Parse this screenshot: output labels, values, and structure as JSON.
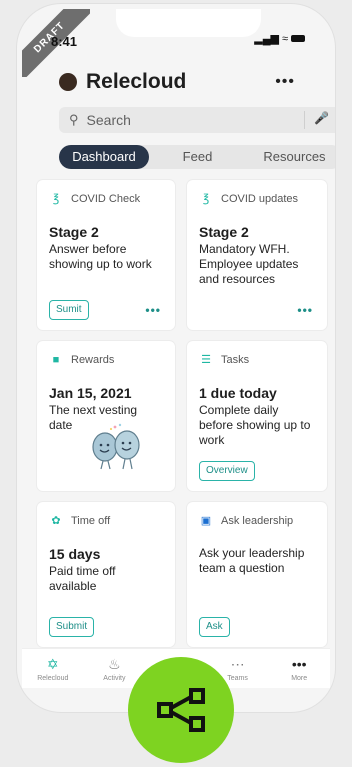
{
  "status_bar": {
    "time": "8:41",
    "signal": "▂▄▆",
    "wifi": "≈"
  },
  "draft_label": "DRAFT",
  "header": {
    "title": "Relecloud",
    "more": "•••"
  },
  "search": {
    "placeholder": "Search"
  },
  "tabs": [
    {
      "label": "Dashboard",
      "active": true
    },
    {
      "label": "Feed",
      "active": false
    },
    {
      "label": "Resources",
      "active": false
    }
  ],
  "cards": {
    "covid_check": {
      "label": "COVID Check",
      "title": "Stage 2",
      "body": "Answer before showing up to work",
      "button": "Sumit",
      "more": "•••"
    },
    "covid_updates": {
      "label": "COVID updates",
      "title": "Stage 2",
      "body": "Mandatory WFH. Employee updates and resources",
      "more": "•••"
    },
    "rewards": {
      "label": "Rewards",
      "title": "Jan 15, 2021",
      "body": "The next vesting date"
    },
    "tasks": {
      "label": "Tasks",
      "title": "1 due today",
      "body": "Complete daily before showing up to work",
      "button": "Overview"
    },
    "time_off": {
      "label": "Time off",
      "title": "15 days",
      "body": "Paid time off available",
      "button": "Submit"
    },
    "leadership": {
      "label": "Ask leadership",
      "body": "Ask your leadership team a question",
      "button": "Ask"
    }
  },
  "nav": [
    {
      "label": "Relecloud",
      "icon": "relecloud-app-icon",
      "active": true
    },
    {
      "label": "Activity",
      "icon": "bell-icon",
      "active": false
    },
    {
      "label": "",
      "icon": "chat-icon",
      "active": false
    },
    {
      "label": "Teams",
      "icon": "teams-icon",
      "active": false
    },
    {
      "label": "More",
      "icon": "more-icon",
      "active": false
    }
  ],
  "colors": {
    "accent": "#1fb7a3",
    "tab_active": "#283549",
    "fab": "#7ed321"
  }
}
